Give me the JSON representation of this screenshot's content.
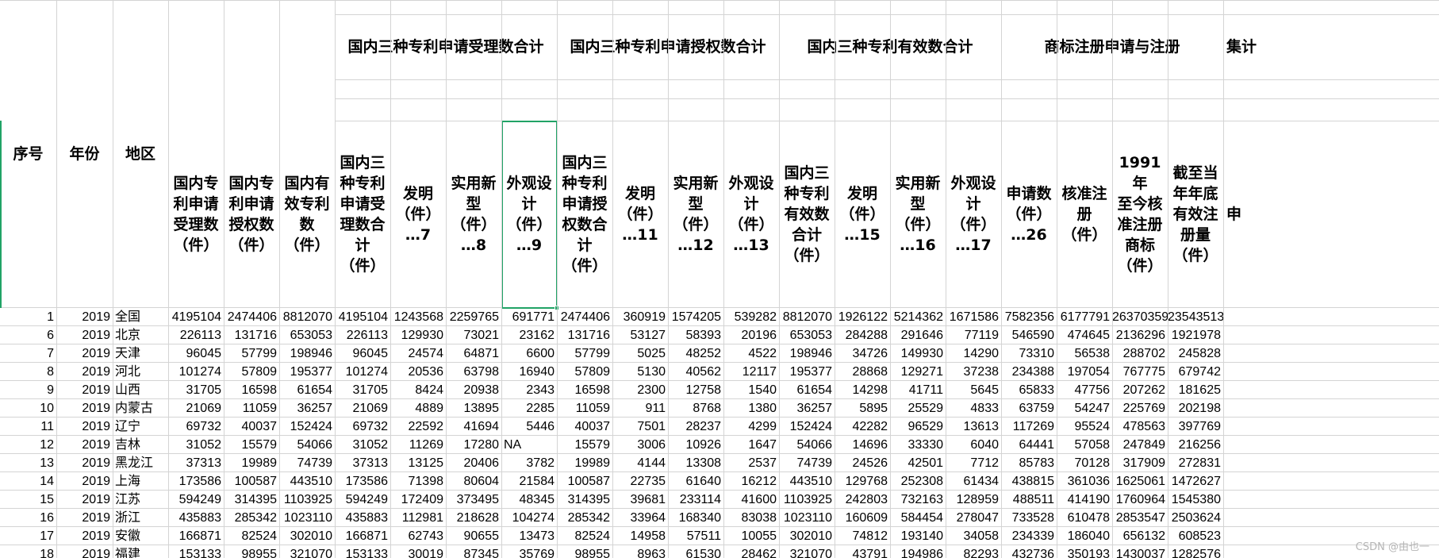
{
  "header": {
    "group_titles": [
      "国内三种专利申请受理数合计",
      "国内三种专利申请授权数合计",
      "国内三种专利有效数合计",
      "商标注册申请与注册",
      "集计"
    ],
    "columns": [
      "序号",
      "年份",
      "地区",
      "国内专\n利申请\n受理数\n（件）",
      "国内专\n利申请\n授权数\n（件）",
      "国内有\n效专利\n数\n（件）",
      "国内三\n种专利\n申请受\n理数合\n计\n（件）",
      "发明\n（件）\n…7",
      "实用新\n型\n（件）\n…8",
      "外观设\n计\n（件）\n…9",
      "国内三\n种专利\n申请授\n权数合\n计\n（件）",
      "发明\n（件）\n…11",
      "实用新\n型\n（件）\n…12",
      "外观设\n计\n（件）\n…13",
      "国内三\n种专利\n有效数\n合计\n（件）",
      "发明\n（件）\n…15",
      "实用新\n型\n（件）\n…16",
      "外观设\n计\n（件）\n…17",
      "申请数\n（件）\n…26",
      "核准注\n册\n（件）",
      "1991年\n至今核\n准注册\n商标\n（件）",
      "截至当\n年年底\n有效注\n册量\n（件）",
      "申"
    ]
  },
  "rows": [
    [
      "1",
      "2019",
      "全国",
      "4195104",
      "2474406",
      "8812070",
      "4195104",
      "1243568",
      "2259765",
      "691771",
      "2474406",
      "360919",
      "1574205",
      "539282",
      "8812070",
      "1926122",
      "5214362",
      "1671586",
      "7582356",
      "6177791",
      "26370359",
      "23543513"
    ],
    [
      "6",
      "2019",
      "北京",
      "226113",
      "131716",
      "653053",
      "226113",
      "129930",
      "73021",
      "23162",
      "131716",
      "53127",
      "58393",
      "20196",
      "653053",
      "284288",
      "291646",
      "77119",
      "546590",
      "474645",
      "2136296",
      "1921978"
    ],
    [
      "7",
      "2019",
      "天津",
      "96045",
      "57799",
      "198946",
      "96045",
      "24574",
      "64871",
      "6600",
      "57799",
      "5025",
      "48252",
      "4522",
      "198946",
      "34726",
      "149930",
      "14290",
      "73310",
      "56538",
      "288702",
      "245828"
    ],
    [
      "8",
      "2019",
      "河北",
      "101274",
      "57809",
      "195377",
      "101274",
      "20536",
      "63798",
      "16940",
      "57809",
      "5130",
      "40562",
      "12117",
      "195377",
      "28868",
      "129271",
      "37238",
      "234388",
      "197054",
      "767775",
      "679742"
    ],
    [
      "9",
      "2019",
      "山西",
      "31705",
      "16598",
      "61654",
      "31705",
      "8424",
      "20938",
      "2343",
      "16598",
      "2300",
      "12758",
      "1540",
      "61654",
      "14298",
      "41711",
      "5645",
      "65833",
      "47756",
      "207262",
      "181625"
    ],
    [
      "10",
      "2019",
      "内蒙古",
      "21069",
      "11059",
      "36257",
      "21069",
      "4889",
      "13895",
      "2285",
      "11059",
      "911",
      "8768",
      "1380",
      "36257",
      "5895",
      "25529",
      "4833",
      "63759",
      "54247",
      "225769",
      "202198"
    ],
    [
      "11",
      "2019",
      "辽宁",
      "69732",
      "40037",
      "152424",
      "69732",
      "22592",
      "41694",
      "5446",
      "40037",
      "7501",
      "28237",
      "4299",
      "152424",
      "42282",
      "96529",
      "13613",
      "117269",
      "95524",
      "478563",
      "397769"
    ],
    [
      "12",
      "2019",
      "吉林",
      "31052",
      "15579",
      "54066",
      "31052",
      "11269",
      "17280",
      "NA",
      "15579",
      "3006",
      "10926",
      "1647",
      "54066",
      "14696",
      "33330",
      "6040",
      "64441",
      "57058",
      "247849",
      "216256"
    ],
    [
      "13",
      "2019",
      "黑龙江",
      "37313",
      "19989",
      "74739",
      "37313",
      "13125",
      "20406",
      "3782",
      "19989",
      "4144",
      "13308",
      "2537",
      "74739",
      "24526",
      "42501",
      "7712",
      "85783",
      "70128",
      "317909",
      "272831"
    ],
    [
      "14",
      "2019",
      "上海",
      "173586",
      "100587",
      "443510",
      "173586",
      "71398",
      "80604",
      "21584",
      "100587",
      "22735",
      "61640",
      "16212",
      "443510",
      "129768",
      "252308",
      "61434",
      "438815",
      "361036",
      "1625061",
      "1472627"
    ],
    [
      "15",
      "2019",
      "江苏",
      "594249",
      "314395",
      "1103925",
      "594249",
      "172409",
      "373495",
      "48345",
      "314395",
      "39681",
      "233114",
      "41600",
      "1103925",
      "242803",
      "732163",
      "128959",
      "488511",
      "414190",
      "1760964",
      "1545380"
    ],
    [
      "16",
      "2019",
      "浙江",
      "435883",
      "285342",
      "1023110",
      "435883",
      "112981",
      "218628",
      "104274",
      "285342",
      "33964",
      "168340",
      "83038",
      "1023110",
      "160609",
      "584454",
      "278047",
      "733528",
      "610478",
      "2853547",
      "2503624"
    ],
    [
      "17",
      "2019",
      "安徽",
      "166871",
      "82524",
      "302010",
      "166871",
      "62743",
      "90655",
      "13473",
      "82524",
      "14958",
      "57511",
      "10055",
      "302010",
      "74812",
      "193140",
      "34058",
      "234339",
      "186040",
      "656132",
      "608523"
    ],
    [
      "18",
      "2019",
      "福建",
      "153133",
      "98955",
      "321070",
      "153133",
      "30019",
      "87345",
      "35769",
      "98955",
      "8963",
      "61530",
      "28462",
      "321070",
      "43791",
      "194986",
      "82293",
      "432736",
      "350193",
      "1430037",
      "1282576"
    ]
  ],
  "watermark": "CSDN @由也一"
}
